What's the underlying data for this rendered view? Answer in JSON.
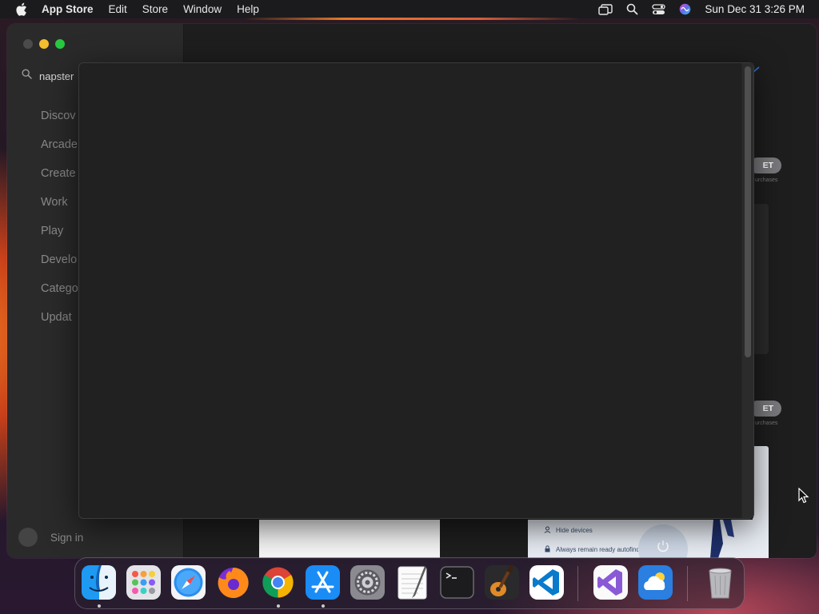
{
  "menubar": {
    "apple_icon": "apple-logo-icon",
    "app_name": "App Store",
    "menus": [
      "Edit",
      "Store",
      "Window",
      "Help"
    ],
    "status_icons": [
      "screen-mirroring-icon",
      "spotlight-search-icon",
      "control-center-icon",
      "siri-icon"
    ],
    "clock": "Sun Dec 31  3:26 PM"
  },
  "sidebar": {
    "search_value": "napster",
    "items": [
      "Discov",
      "Arcade",
      "Create",
      "Work",
      "Play",
      "Develo",
      "Catego",
      "Updat"
    ],
    "signin_label": "Sign in"
  },
  "main_fragments": {
    "get_label": "ET",
    "get_sub": "urchases",
    "list_rows": [
      "Hide devices",
      "Always remain ready autofind"
    ]
  },
  "colors": {
    "accent": "#2a6fd6",
    "traffic_close": "#4b4b4c",
    "traffic_minimize": "#f4bd2e",
    "traffic_zoom": "#28c840"
  },
  "dock": {
    "apps": [
      "Finder",
      "Launchpad",
      "Safari",
      "Firefox",
      "Google Chrome",
      "App Store",
      "System Settings",
      "TextEdit",
      "Terminal",
      "GarageBand",
      "Visual Studio Code",
      "Visual Studio",
      "Weather",
      "Trash"
    ],
    "running": [
      "Finder",
      "Google Chrome",
      "App Store"
    ]
  }
}
